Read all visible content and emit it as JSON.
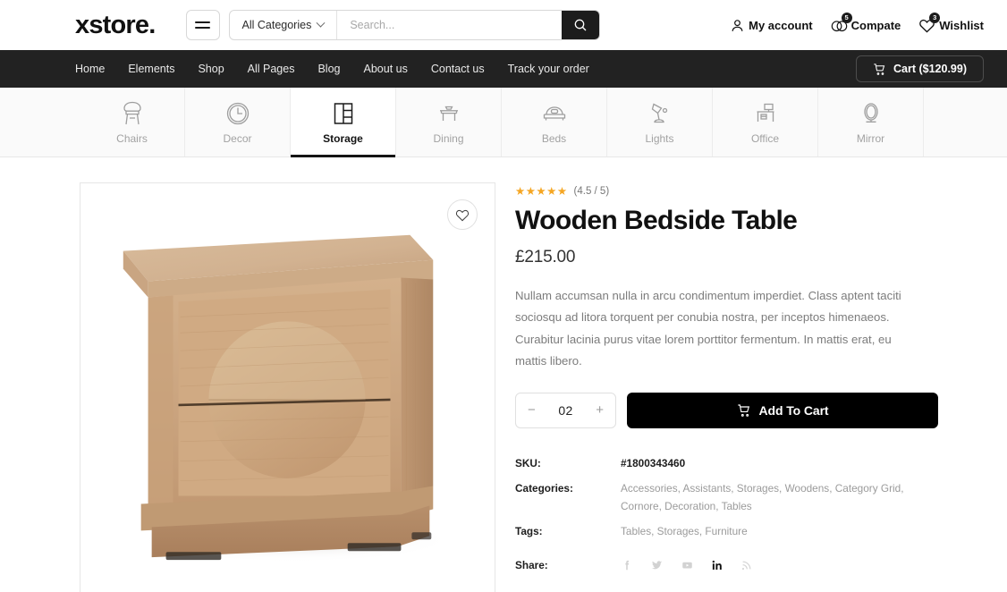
{
  "header": {
    "logo": "xstore.",
    "menu_icon": "hamburger-icon",
    "search": {
      "category_label": "All Categories",
      "placeholder": "Search...",
      "value": "",
      "button_icon": "search-icon"
    },
    "actions": [
      {
        "label": "My account",
        "icon": "user-icon",
        "badge": ""
      },
      {
        "label": "Compate",
        "icon": "compare-icon",
        "badge": "5"
      },
      {
        "label": "Wishlist",
        "icon": "heart-icon",
        "badge": "3"
      }
    ]
  },
  "nav": {
    "links": [
      "Home",
      "Elements",
      "Shop",
      "All Pages",
      "Blog",
      "About us",
      "Contact us",
      "Track your order"
    ],
    "cart": {
      "label": "Cart ($120.99)",
      "icon": "cart-icon",
      "total": "$120.99"
    }
  },
  "categories": {
    "items": [
      {
        "label": "Chairs",
        "icon": "chair-icon",
        "active": false
      },
      {
        "label": "Decor",
        "icon": "clock-icon",
        "active": false
      },
      {
        "label": "Storage",
        "icon": "cabinet-icon",
        "active": true
      },
      {
        "label": "Dining",
        "icon": "table-icon",
        "active": false
      },
      {
        "label": "Beds",
        "icon": "bed-icon",
        "active": false
      },
      {
        "label": "Lights",
        "icon": "lamp-icon",
        "active": false
      },
      {
        "label": "Office",
        "icon": "desk-icon",
        "active": false
      },
      {
        "label": "Mirror",
        "icon": "mirror-icon",
        "active": false
      }
    ]
  },
  "product": {
    "wishlist_icon": "heart-outline-icon",
    "image_alt": "Wooden Bedside Table",
    "rating": {
      "stars": "★★★★★",
      "value": "(4.5 / 5)",
      "star_color": "#f5a623"
    },
    "title": "Wooden Bedside Table",
    "price": "£215.00",
    "description": "Nullam accumsan nulla in arcu condimentum imperdiet. Class aptent taciti sociosqu ad litora torquent per conubia nostra, per inceptos himenaeos. Curabitur lacinia purus vitae lorem porttitor fermentum. In mattis erat, eu mattis libero.",
    "quantity": {
      "value": "02",
      "minus": "−",
      "plus": "+"
    },
    "add_to_cart": {
      "label": "Add To Cart",
      "icon": "cart-icon"
    },
    "meta": {
      "sku_label": "SKU:",
      "sku_value": "#1800343460",
      "categories_label": "Categories:",
      "categories_value": "Accessories, Assistants, Storages, Woodens, Category Grid, Cornore, Decoration, Tables",
      "tags_label": "Tags:",
      "tags_value": "Tables, Storages, Furniture"
    },
    "share": {
      "label": "Share:",
      "icons": [
        {
          "name": "facebook-icon",
          "active": false
        },
        {
          "name": "twitter-icon",
          "active": false
        },
        {
          "name": "youtube-icon",
          "active": false
        },
        {
          "name": "linkedin-icon",
          "active": true
        },
        {
          "name": "rss-icon",
          "active": false
        }
      ]
    }
  }
}
